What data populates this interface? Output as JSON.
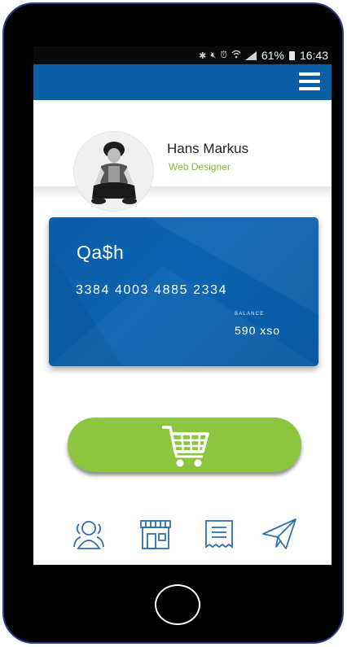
{
  "status_bar": {
    "icons": [
      "bluetooth-icon",
      "mute-icon",
      "alarm-icon",
      "wifi-icon",
      "signal-icon"
    ],
    "battery_percent": "61%",
    "time": "16:43"
  },
  "app_bar": {
    "menu_icon": "hamburger-menu-icon",
    "color": "#0a5ea3"
  },
  "profile": {
    "name": "Hans Markus",
    "role": "Web Designer"
  },
  "card": {
    "brand": "Qa$h",
    "number": "3384 4003 4885 2334",
    "balance_label": "BALANCE",
    "balance": "590 xso"
  },
  "cart_button": {
    "icon": "shopping-cart-icon",
    "color": "#8cc63f"
  },
  "bottom_nav": [
    {
      "icon": "users-icon"
    },
    {
      "icon": "store-icon"
    },
    {
      "icon": "receipt-icon"
    },
    {
      "icon": "send-icon"
    }
  ]
}
